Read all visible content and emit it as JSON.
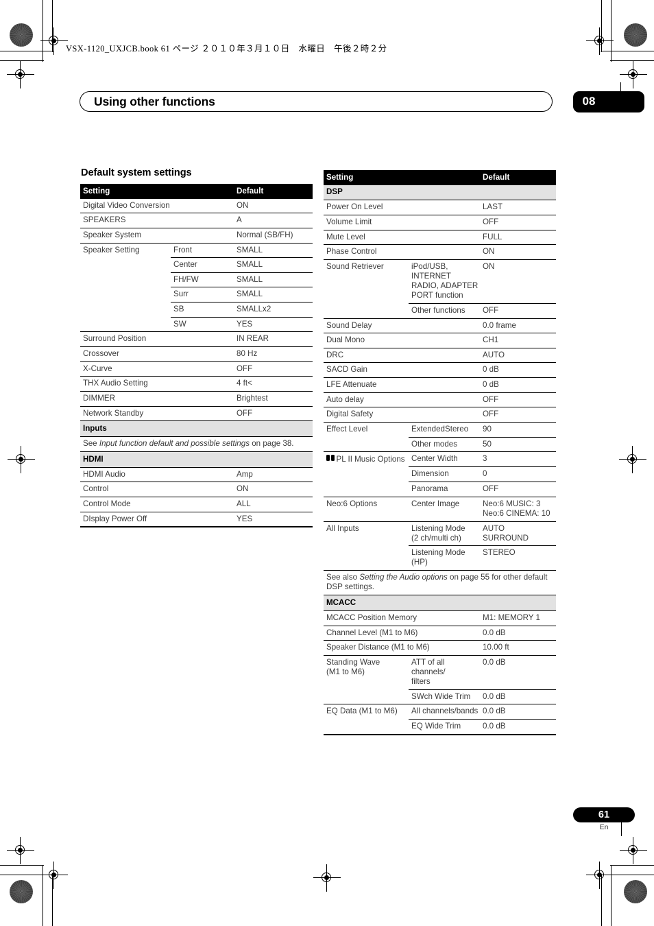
{
  "print_marks": {
    "book_line": "VSX-1120_UXJCB.book   61 ページ   ２０１０年３月１０日　水曜日　午後２時２分"
  },
  "header": {
    "chapter_title": "Using other functions",
    "chapter_number": "08"
  },
  "footer": {
    "page_number": "61",
    "language": "En"
  },
  "content": {
    "section_title": "Default system settings"
  },
  "left_table": {
    "header": {
      "setting": "Setting",
      "default": "Default"
    },
    "rows": [
      {
        "kind": "row",
        "c1": "Digital Video Conversion",
        "c2": "",
        "c3": "ON"
      },
      {
        "kind": "row",
        "c1": "SPEAKERS",
        "c2": "",
        "c3": "A"
      },
      {
        "kind": "row",
        "c1": "Speaker System",
        "c2": "",
        "c3": "Normal (SB/FH)"
      },
      {
        "kind": "sub",
        "c1": "Speaker Setting",
        "c2": "Front",
        "c3": "SMALL"
      },
      {
        "kind": "sub",
        "c1": "",
        "c2": "Center",
        "c3": "SMALL"
      },
      {
        "kind": "sub",
        "c1": "",
        "c2": "FH/FW",
        "c3": "SMALL"
      },
      {
        "kind": "sub",
        "c1": "",
        "c2": "Surr",
        "c3": "SMALL"
      },
      {
        "kind": "sub",
        "c1": "",
        "c2": "SB",
        "c3": "SMALLx2"
      },
      {
        "kind": "row",
        "c1": "",
        "c2": "SW",
        "c3": "YES"
      },
      {
        "kind": "row",
        "c1": "Surround Position",
        "c2": "",
        "c3": "IN REAR"
      },
      {
        "kind": "row",
        "c1": "Crossover",
        "c2": "",
        "c3": "80 Hz"
      },
      {
        "kind": "row",
        "c1": "X-Curve",
        "c2": "",
        "c3": "OFF"
      },
      {
        "kind": "row",
        "c1": "THX Audio Setting",
        "c2": "",
        "c3": "4 ft<"
      },
      {
        "kind": "row",
        "c1": "DIMMER",
        "c2": "",
        "c3": "Brightest"
      },
      {
        "kind": "row",
        "c1": "Network Standby",
        "c2": "",
        "c3": "OFF"
      },
      {
        "kind": "band",
        "c1": "Inputs"
      },
      {
        "kind": "note",
        "pre": "See ",
        "em": "Input function default and possible settings",
        "post": " on page 38."
      },
      {
        "kind": "band",
        "c1": "HDMI"
      },
      {
        "kind": "row",
        "c1": "HDMI Audio",
        "c2": "",
        "c3": "Amp"
      },
      {
        "kind": "row",
        "c1": "Control",
        "c2": "",
        "c3": "ON"
      },
      {
        "kind": "row",
        "c1": "Control Mode",
        "c2": "",
        "c3": "ALL"
      },
      {
        "kind": "last",
        "c1": "DIsplay Power Off",
        "c2": "",
        "c3": "YES"
      }
    ]
  },
  "right_table": {
    "header": {
      "setting": "Setting",
      "default": "Default"
    },
    "rows": [
      {
        "kind": "band",
        "c1": "DSP"
      },
      {
        "kind": "row",
        "c1": "Power On Level",
        "c2": "",
        "c3": "LAST"
      },
      {
        "kind": "row",
        "c1": "Volume Limit",
        "c2": "",
        "c3": "OFF"
      },
      {
        "kind": "row",
        "c1": "Mute Level",
        "c2": "",
        "c3": "FULL"
      },
      {
        "kind": "row",
        "c1": "Phase Control",
        "c2": "",
        "c3": "ON"
      },
      {
        "kind": "sub",
        "c1": "Sound Retriever",
        "c2": "iPod/USB, INTERNET RADIO, ADAPTER PORT function",
        "c3": "ON"
      },
      {
        "kind": "row",
        "c1": "",
        "c2": "Other functions",
        "c3": "OFF"
      },
      {
        "kind": "row",
        "c1": "Sound Delay",
        "c2": "",
        "c3": "0.0 frame"
      },
      {
        "kind": "row",
        "c1": "Dual Mono",
        "c2": "",
        "c3": "CH1"
      },
      {
        "kind": "row",
        "c1": "DRC",
        "c2": "",
        "c3": "AUTO"
      },
      {
        "kind": "row",
        "c1": "SACD Gain",
        "c2": "",
        "c3": "0 dB"
      },
      {
        "kind": "row",
        "c1": "LFE Attenuate",
        "c2": "",
        "c3": "0 dB"
      },
      {
        "kind": "row",
        "c1": "Auto delay",
        "c2": "",
        "c3": "OFF"
      },
      {
        "kind": "row",
        "c1": "Digital Safety",
        "c2": "",
        "c3": "OFF"
      },
      {
        "kind": "sub",
        "c1": "Effect Level",
        "c2": "ExtendedStereo",
        "c3": "90"
      },
      {
        "kind": "row",
        "c1": "",
        "c2": "Other modes",
        "c3": "50"
      },
      {
        "kind": "sub",
        "c1": "PL II Music Options",
        "c1_icon": "dolby-logo-icon",
        "c2": "Center Width",
        "c3": "3"
      },
      {
        "kind": "sub",
        "c1": "",
        "c2": "Dimension",
        "c3": "0"
      },
      {
        "kind": "row",
        "c1": "",
        "c2": "Panorama",
        "c3": "OFF"
      },
      {
        "kind": "row",
        "c1": "Neo:6 Options",
        "c2": "Center Image",
        "c3": "Neo:6 MUSIC: 3\nNeo:6 CINEMA: 10"
      },
      {
        "kind": "sub",
        "c1": "All Inputs",
        "c2": "Listening Mode\n(2 ch/multi ch)",
        "c3": "AUTO\nSURROUND"
      },
      {
        "kind": "row",
        "c1": "",
        "c2": "Listening Mode (HP)",
        "c3": "STEREO"
      },
      {
        "kind": "note",
        "pre": "See also ",
        "em": "Setting the Audio options",
        "post": " on page 55 for other default DSP settings."
      },
      {
        "kind": "band",
        "c1": "MCACC"
      },
      {
        "kind": "row",
        "c1": "MCACC Position Memory",
        "c2": "",
        "c3": "M1: MEMORY 1"
      },
      {
        "kind": "row",
        "c1": "Channel Level (M1 to M6)",
        "c2": "",
        "c3": "0.0 dB"
      },
      {
        "kind": "row",
        "c1": "Speaker Distance (M1 to M6)",
        "c2": "",
        "c3": "10.00 ft"
      },
      {
        "kind": "sub",
        "c1": "Standing Wave\n(M1 to M6)",
        "c2": "ATT of all channels/\nfilters",
        "c3": "0.0 dB"
      },
      {
        "kind": "row",
        "c1": "",
        "c2": "SWch Wide Trim",
        "c3": "0.0 dB"
      },
      {
        "kind": "sub",
        "c1": "EQ Data (M1 to M6)",
        "c2": "All channels/bands",
        "c3": "0.0 dB"
      },
      {
        "kind": "last",
        "c1": "",
        "c2": "EQ Wide Trim",
        "c3": "0.0 dB"
      }
    ]
  }
}
